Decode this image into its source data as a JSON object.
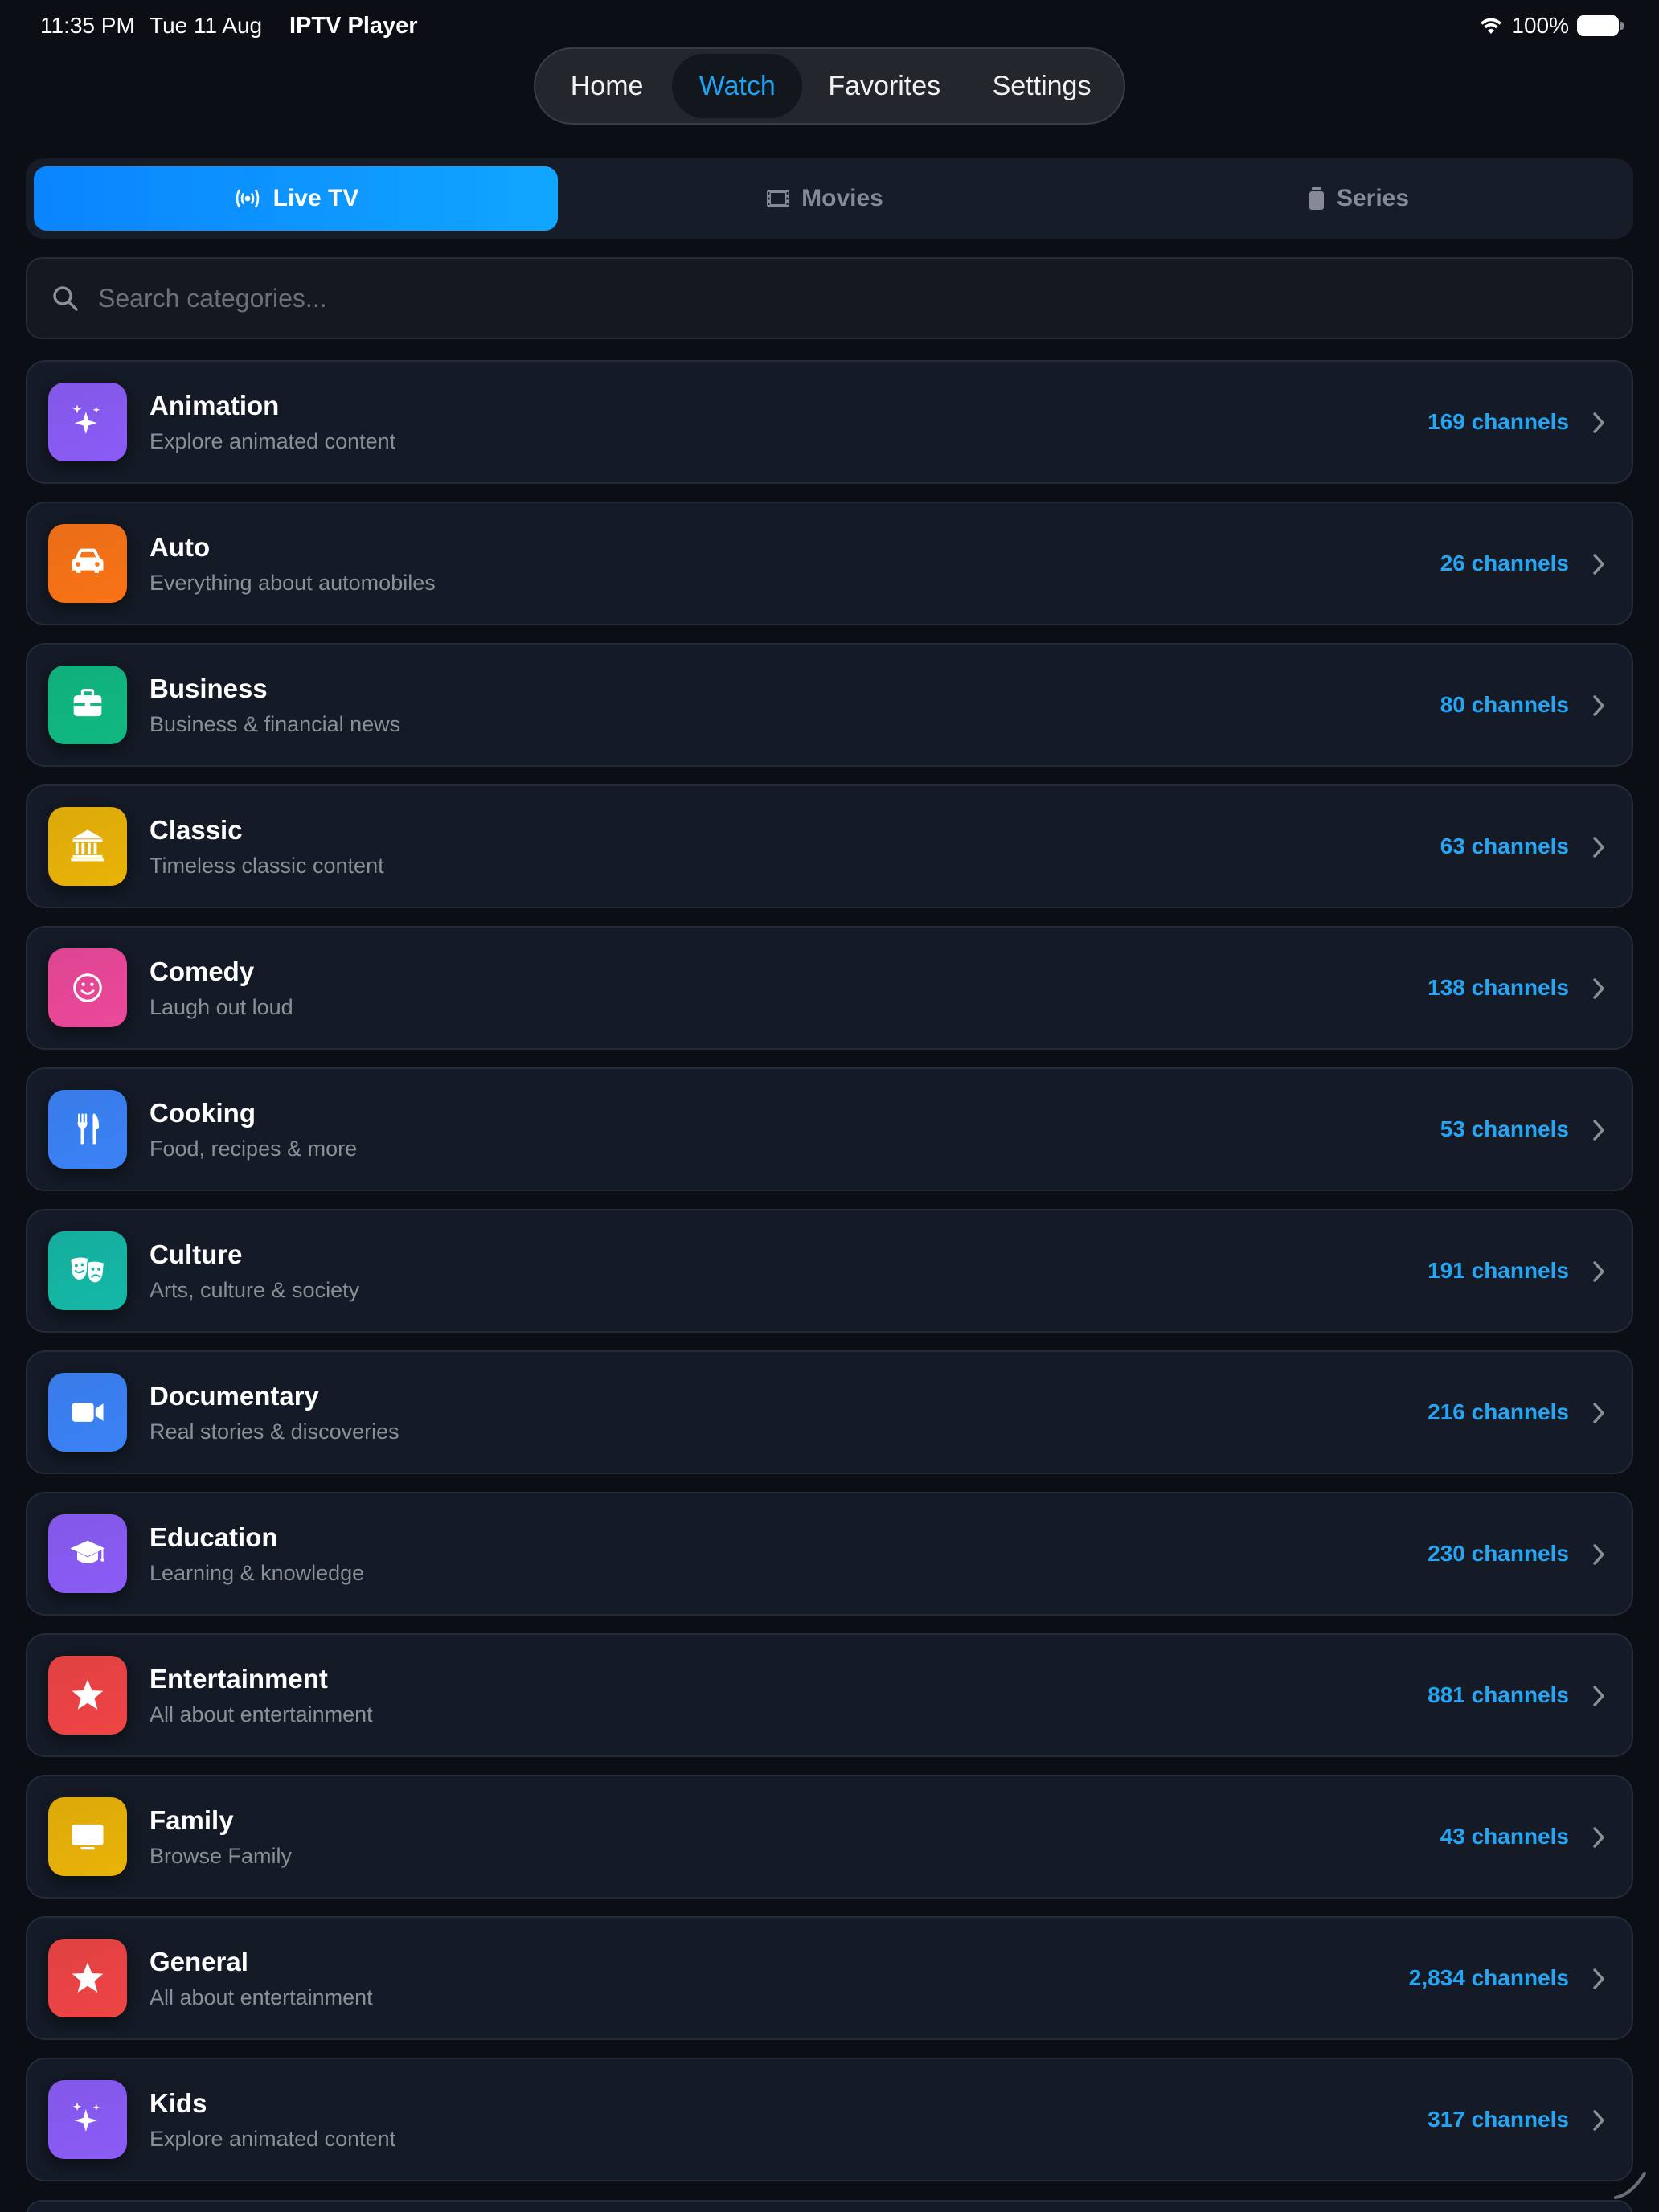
{
  "status_bar": {
    "time": "11:35 PM",
    "date": "Tue 11 Aug",
    "app_name": "IPTV Player",
    "battery": "100%"
  },
  "top_nav": {
    "items": [
      "Home",
      "Watch",
      "Favorites",
      "Settings"
    ],
    "selected": "Watch"
  },
  "segments": {
    "live": "Live TV",
    "movies": "Movies",
    "series": "Series",
    "selected": "Live TV"
  },
  "search": {
    "placeholder": "Search categories...",
    "value": ""
  },
  "colors": {
    "accent": "#1fa3f5",
    "count": "#27a5f2",
    "background": "#0b0e15",
    "card": "#141a26"
  },
  "categories": [
    {
      "title": "Animation",
      "subtitle": "Explore animated content",
      "count": "169 channels",
      "icon": "sparkles-icon",
      "color": "#8b5cf6"
    },
    {
      "title": "Auto",
      "subtitle": "Everything about automobiles",
      "count": "26 channels",
      "icon": "car-icon",
      "color": "#f97316"
    },
    {
      "title": "Business",
      "subtitle": "Business & financial news",
      "count": "80 channels",
      "icon": "briefcase-icon",
      "color": "#10b981"
    },
    {
      "title": "Classic",
      "subtitle": "Timeless classic content",
      "count": "63 channels",
      "icon": "building-columns-icon",
      "color": "#eab308"
    },
    {
      "title": "Comedy",
      "subtitle": "Laugh out loud",
      "count": "138 channels",
      "icon": "smiley-icon",
      "color": "#ec4899"
    },
    {
      "title": "Cooking",
      "subtitle": "Food, recipes & more",
      "count": "53 channels",
      "icon": "fork-knife-icon",
      "color": "#3b82f6"
    },
    {
      "title": "Culture",
      "subtitle": "Arts, culture & society",
      "count": "191 channels",
      "icon": "theater-masks-icon",
      "color": "#14b8a6"
    },
    {
      "title": "Documentary",
      "subtitle": "Real stories & discoveries",
      "count": "216 channels",
      "icon": "video-camera-icon",
      "color": "#3b82f6"
    },
    {
      "title": "Education",
      "subtitle": "Learning & knowledge",
      "count": "230 channels",
      "icon": "graduation-cap-icon",
      "color": "#8b5cf6"
    },
    {
      "title": "Entertainment",
      "subtitle": "All about entertainment",
      "count": "881 channels",
      "icon": "star-icon",
      "color": "#ef4444"
    },
    {
      "title": "Family",
      "subtitle": "Browse Family",
      "count": "43 channels",
      "icon": "tv-icon",
      "color": "#eab308"
    },
    {
      "title": "General",
      "subtitle": "All about entertainment",
      "count": "2,834 channels",
      "icon": "star-icon",
      "color": "#ef4444"
    },
    {
      "title": "Kids",
      "subtitle": "Explore animated content",
      "count": "317 channels",
      "icon": "sparkles-icon",
      "color": "#8b5cf6"
    }
  ]
}
